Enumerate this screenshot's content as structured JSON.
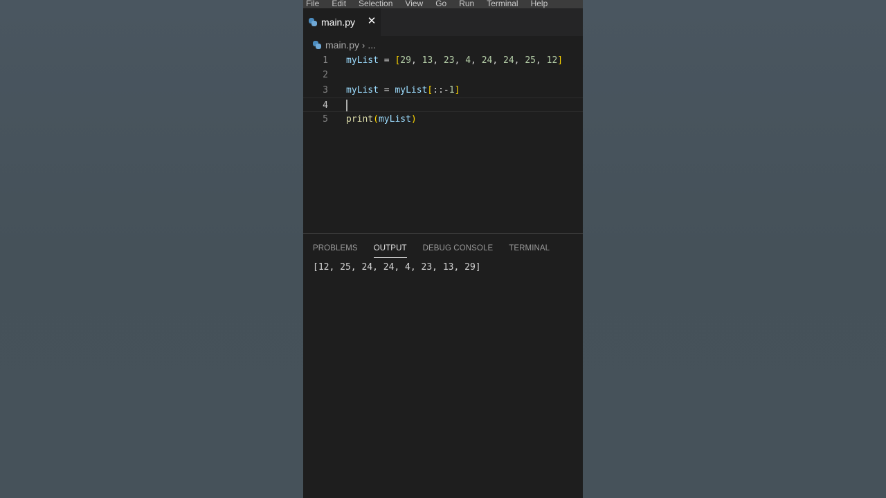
{
  "menubar": {
    "items": [
      "File",
      "Edit",
      "Selection",
      "View",
      "Go",
      "Run",
      "Terminal",
      "Help"
    ]
  },
  "tab": {
    "label": "main.py",
    "close_glyph": "✕",
    "icon": "python-file-icon"
  },
  "breadcrumb": {
    "file": "main.py",
    "separator": "›",
    "ellipsis": "..."
  },
  "code": {
    "active_line": 4,
    "lines": [
      {
        "number": "1",
        "tokens": [
          {
            "t": "myList",
            "c": "var"
          },
          {
            "t": " = ",
            "c": ""
          },
          {
            "t": "[",
            "c": "br"
          },
          {
            "t": "29",
            "c": "num"
          },
          {
            "t": ", ",
            "c": ""
          },
          {
            "t": "13",
            "c": "num"
          },
          {
            "t": ", ",
            "c": ""
          },
          {
            "t": "23",
            "c": "num"
          },
          {
            "t": ", ",
            "c": ""
          },
          {
            "t": "4",
            "c": "num"
          },
          {
            "t": ", ",
            "c": ""
          },
          {
            "t": "24",
            "c": "num"
          },
          {
            "t": ", ",
            "c": ""
          },
          {
            "t": "24",
            "c": "num"
          },
          {
            "t": ", ",
            "c": ""
          },
          {
            "t": "25",
            "c": "num"
          },
          {
            "t": ", ",
            "c": ""
          },
          {
            "t": "12",
            "c": "num"
          },
          {
            "t": "]",
            "c": "br"
          }
        ]
      },
      {
        "number": "2",
        "tokens": []
      },
      {
        "number": "3",
        "tokens": [
          {
            "t": "myList",
            "c": "var"
          },
          {
            "t": " = ",
            "c": ""
          },
          {
            "t": "myList",
            "c": "var"
          },
          {
            "t": "[",
            "c": "br"
          },
          {
            "t": "::-",
            "c": ""
          },
          {
            "t": "1",
            "c": "num"
          },
          {
            "t": "]",
            "c": "br"
          }
        ]
      },
      {
        "number": "4",
        "tokens": []
      },
      {
        "number": "5",
        "tokens": [
          {
            "t": "print",
            "c": "fn"
          },
          {
            "t": "(",
            "c": "br"
          },
          {
            "t": "myList",
            "c": "var"
          },
          {
            "t": ")",
            "c": "br"
          }
        ]
      }
    ]
  },
  "panel": {
    "tabs": [
      {
        "label": "PROBLEMS",
        "active": false
      },
      {
        "label": "OUTPUT",
        "active": true
      },
      {
        "label": "DEBUG CONSOLE",
        "active": false
      },
      {
        "label": "TERMINAL",
        "active": false
      }
    ],
    "output": "[12, 25, 24, 24, 4, 23, 13, 29]"
  },
  "colors": {
    "editor_bg": "#1e1e1e",
    "tab_bar_bg": "#252526",
    "page_bg": "#46525a",
    "variable": "#9cdcfe",
    "function": "#dcdcaa",
    "number": "#b5cea8",
    "bracket": "#ffd700"
  }
}
